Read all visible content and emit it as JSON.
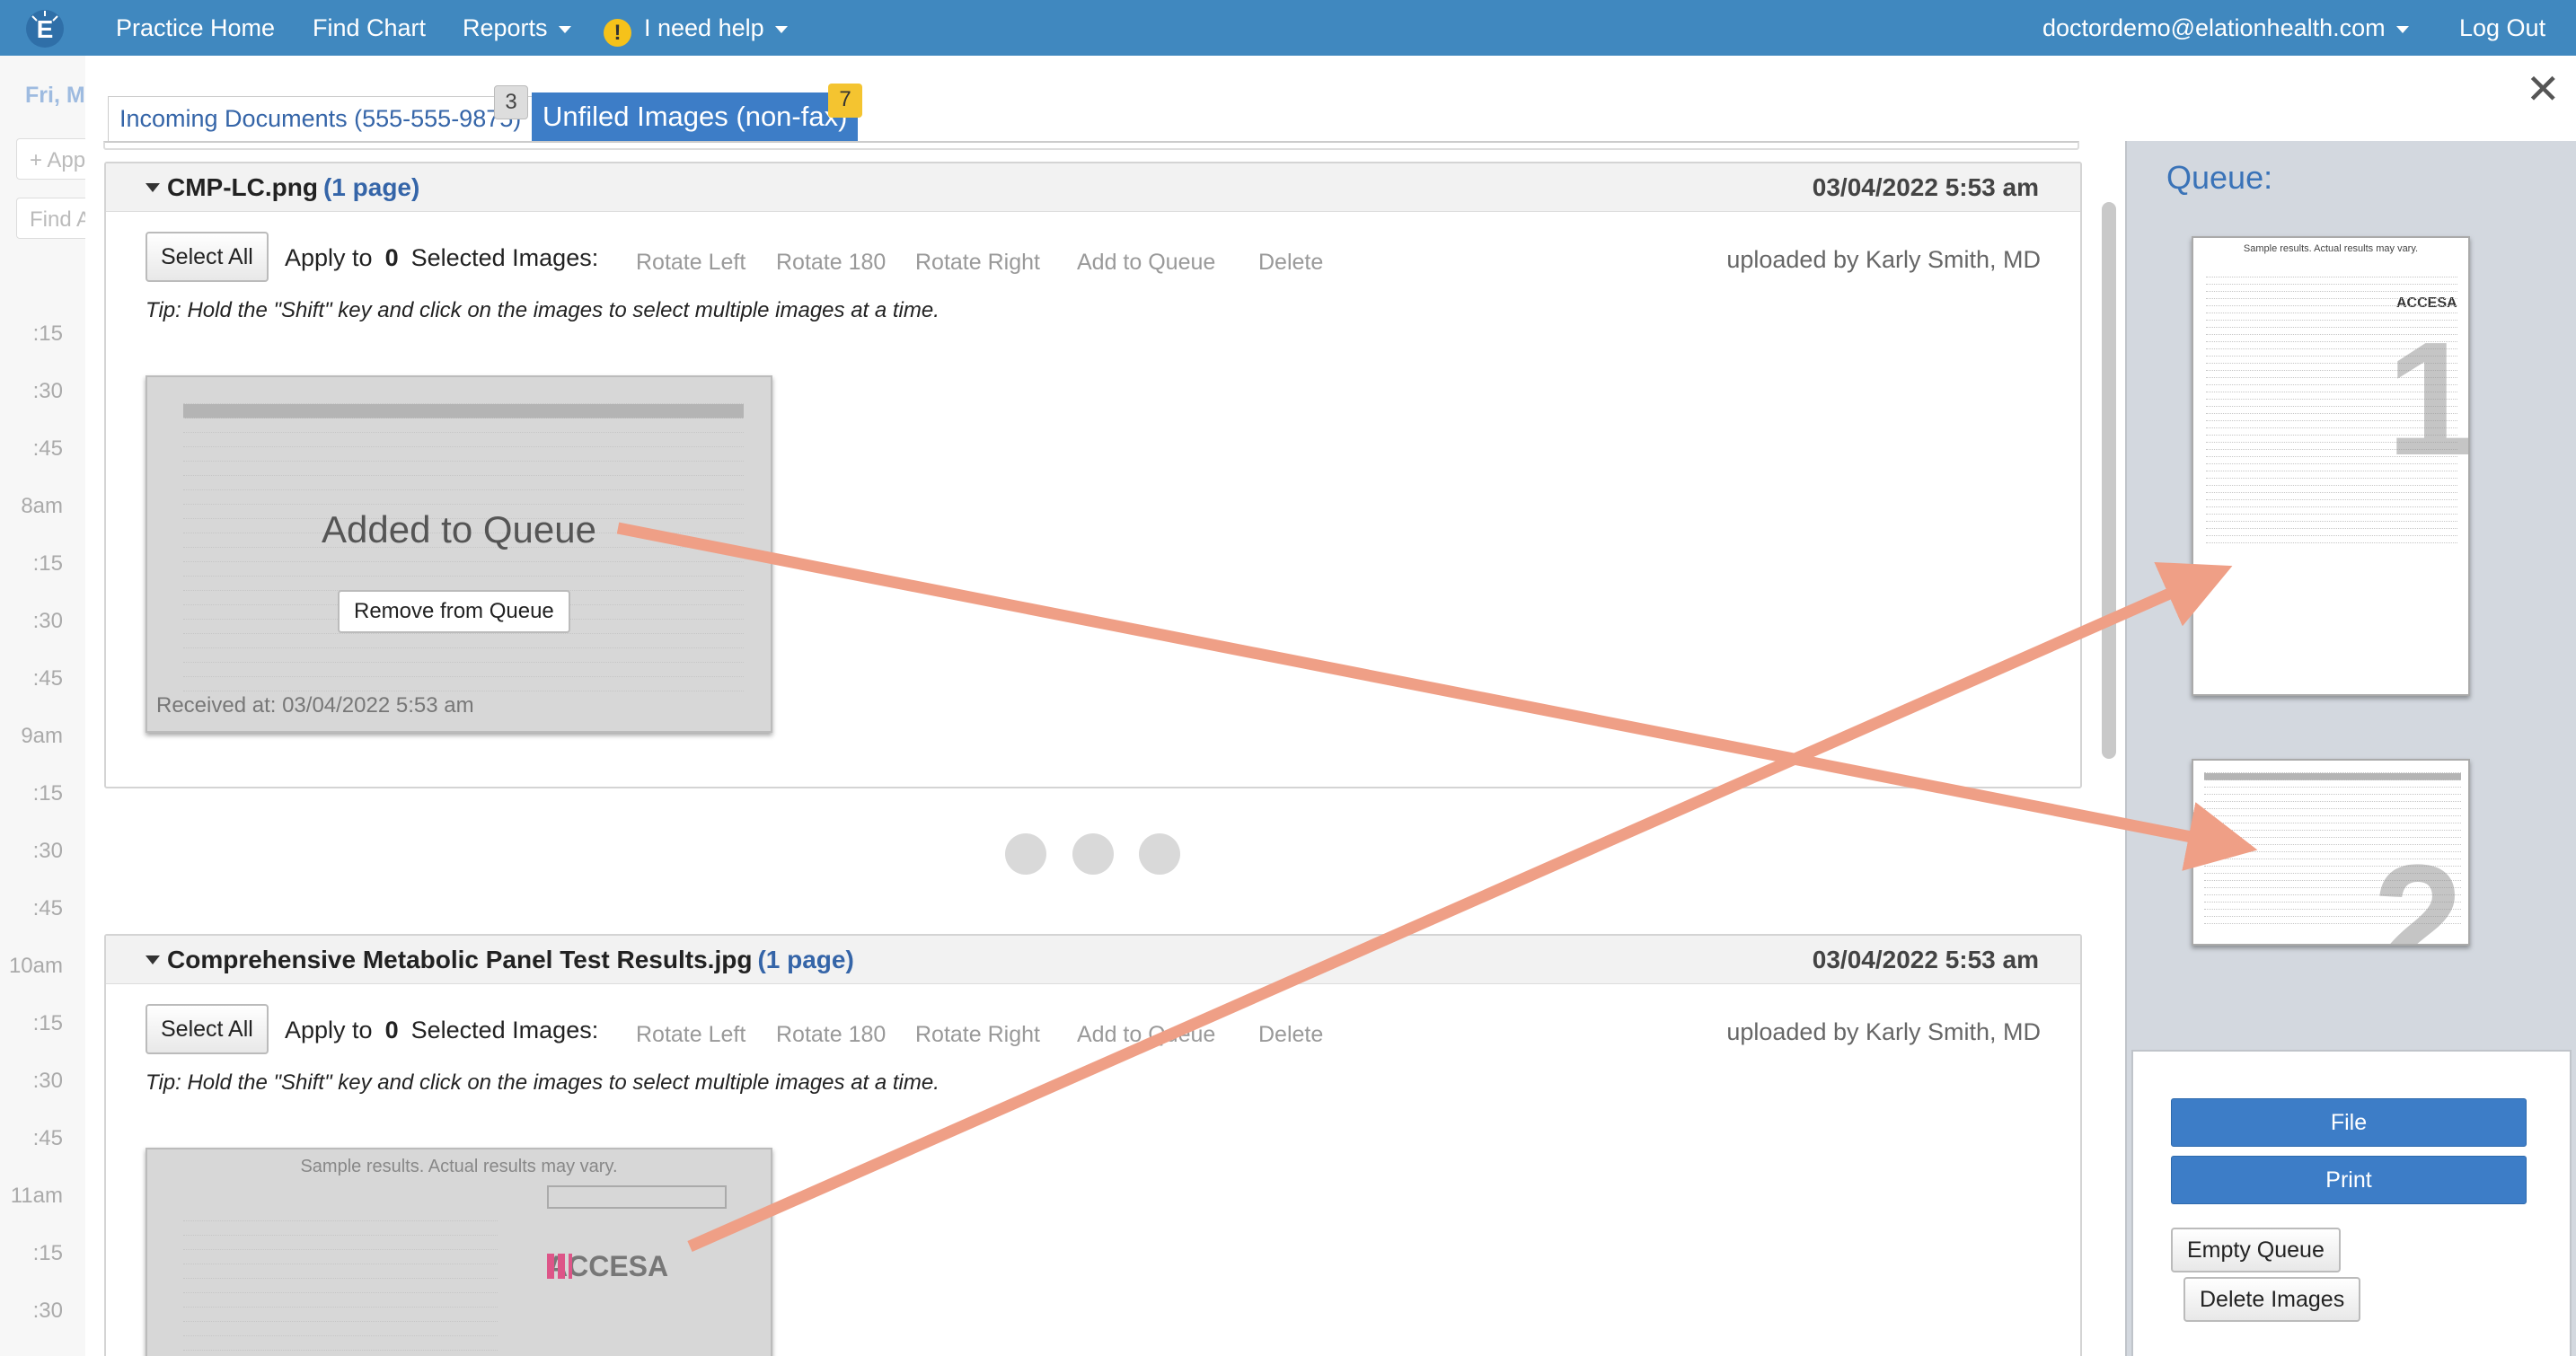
{
  "nav": {
    "practice_home": "Practice Home",
    "find_chart": "Find Chart",
    "reports": "Reports",
    "help": "I need help",
    "help_icon": "!",
    "user": "doctordemo@elationhealth.com",
    "logout": "Log Out",
    "color": "#4088bf"
  },
  "calendar": {
    "date": "Fri, M",
    "appt_btn": "+ App",
    "find_btn": "Find A",
    "times": [
      ":15",
      ":30",
      ":45",
      "8am",
      ":15",
      ":30",
      ":45",
      "9am",
      ":15",
      ":30",
      ":45",
      "10am",
      ":15",
      ":30",
      ":45",
      "11am",
      ":15",
      ":30"
    ]
  },
  "modal": {
    "close": "✕",
    "tabs": [
      {
        "label": "Incoming Documents (555-555-9875)",
        "badge": "3"
      },
      {
        "label": "Unfiled Images (non-fax)",
        "badge": "7"
      }
    ]
  },
  "documents": [
    {
      "filename": "CMP-LC.png",
      "pages": "(1 page)",
      "date": "03/04/2022 5:53 am",
      "select_all": "Select All",
      "apply_to": "Apply to",
      "selected_count": "0",
      "selected_images": "Selected Images:",
      "actions": [
        "Rotate Left",
        "Rotate 180",
        "Rotate Right",
        "Add to Queue",
        "Delete"
      ],
      "uploaded_by": "uploaded by Karly Smith, MD",
      "tip": "Tip: Hold the \"Shift\" key and click on the images to select multiple images at a time.",
      "overlay_text": "Added to Queue",
      "remove_btn": "Remove from Queue",
      "received": "Received at: 03/04/2022 5:53 am"
    },
    {
      "filename": "Comprehensive Metabolic Panel Test Results.jpg",
      "pages": "(1 page)",
      "date": "03/04/2022 5:53 am",
      "select_all": "Select All",
      "apply_to": "Apply to",
      "selected_count": "0",
      "selected_images": "Selected Images:",
      "actions": [
        "Rotate Left",
        "Rotate 180",
        "Rotate Right",
        "Add to Queue",
        "Delete"
      ],
      "uploaded_by": "uploaded by Karly Smith, MD",
      "tip": "Tip: Hold the \"Shift\" key and click on the images to select multiple images at a time.",
      "thumb_header": "Sample results. Actual results may vary.",
      "thumb_logo": "ACCESA"
    }
  ],
  "queue": {
    "title": "Queue:",
    "items": [
      {
        "number": "1",
        "header": "Sample results. Actual results may vary.",
        "logo": "ACCESA"
      },
      {
        "number": "2"
      }
    ],
    "file_btn": "File",
    "print_btn": "Print",
    "empty_btn": "Empty Queue",
    "delete_btn": "Delete Images"
  },
  "annotation_color": "#ef9f86"
}
